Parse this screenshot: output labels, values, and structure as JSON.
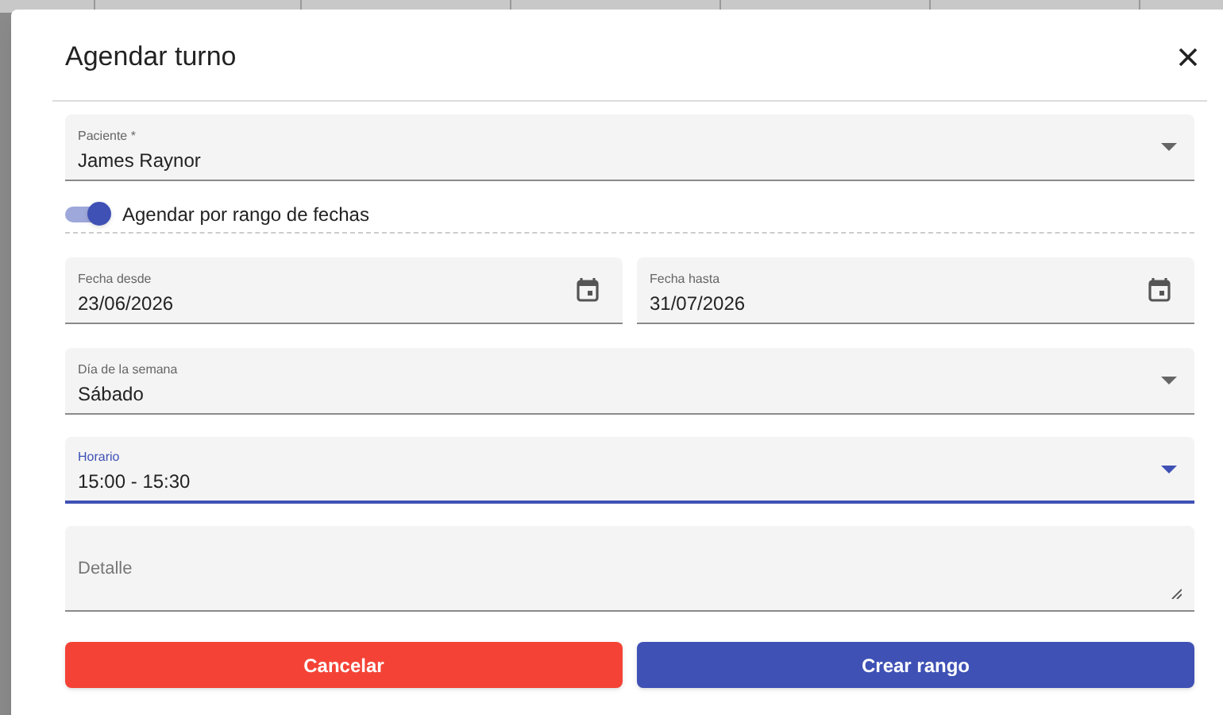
{
  "dialog": {
    "title": "Agendar turno"
  },
  "fields": [
    {
      "kind": "select",
      "label": "Paciente *",
      "value": "James Raynor",
      "focused": false
    },
    {
      "kind": "toggle",
      "label": "Agendar por rango de fechas",
      "on": true
    },
    {
      "kind": "dates",
      "items": [
        {
          "label": "Fecha desde",
          "value": "23/06/2026"
        },
        {
          "label": "Fecha hasta",
          "value": "31/07/2026"
        }
      ]
    },
    {
      "kind": "select",
      "label": "Día de la semana",
      "value": "Sábado",
      "focused": false
    },
    {
      "kind": "select",
      "label": "Horario",
      "value": "15:00 - 15:30",
      "focused": true
    },
    {
      "kind": "textarea",
      "placeholder": "Detalle"
    }
  ],
  "buttons": [
    {
      "label": "Cancelar",
      "kind": "cancel"
    },
    {
      "label": "Crear rango",
      "kind": "primary"
    }
  ]
}
